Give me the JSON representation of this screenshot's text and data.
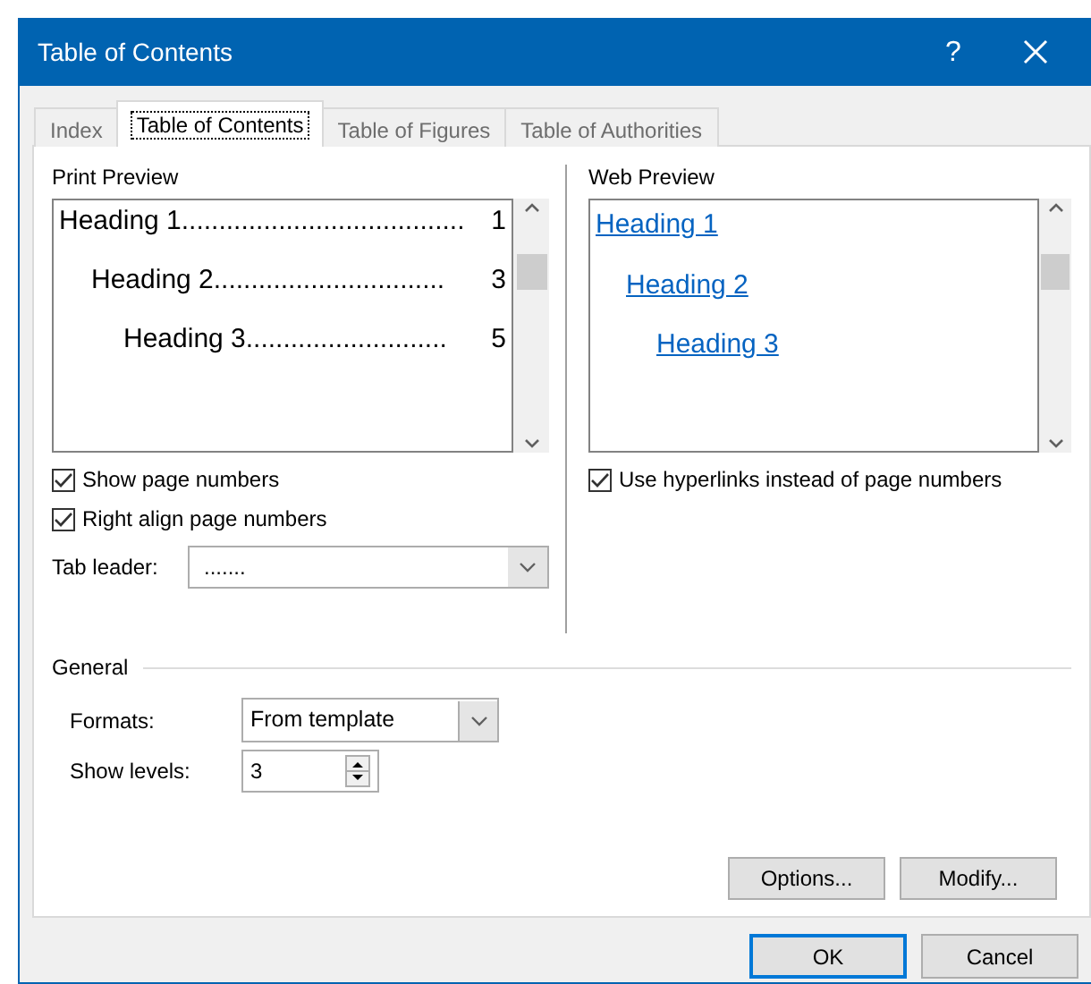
{
  "window": {
    "title": "Table of Contents",
    "help": "?"
  },
  "tabs": [
    {
      "label": "Index",
      "selected": false
    },
    {
      "label": "Table of Contents",
      "selected": true
    },
    {
      "label": "Table of Figures",
      "selected": false
    },
    {
      "label": "Table of Authorities",
      "selected": false
    }
  ],
  "print_preview": {
    "label": "Print Preview",
    "entries": [
      {
        "heading": "Heading 1",
        "leader": "......................................",
        "page": "1",
        "children": [
          {
            "heading": "Heading 2",
            "leader": "...............................",
            "page": "3",
            "children": [
              {
                "heading": "Heading 3",
                "leader": "...........................",
                "page": "5"
              }
            ]
          }
        ]
      }
    ]
  },
  "print_options": [
    {
      "label": "Show page numbers",
      "checked": true
    },
    {
      "label": "Right align page numbers",
      "checked": true
    }
  ],
  "tab_leader": {
    "label": "Tab leader:",
    "value": "......."
  },
  "web_preview": {
    "label": "Web Preview",
    "entries": [
      {
        "heading": "Heading 1",
        "children": [
          {
            "heading": "Heading 2",
            "children": [
              {
                "heading": "Heading 3"
              }
            ]
          }
        ]
      }
    ]
  },
  "web_options": [
    {
      "label": "Use hyperlinks instead of page numbers",
      "checked": true
    }
  ],
  "general": {
    "title": "General",
    "formats": {
      "label": "Formats:",
      "value": "From template"
    },
    "show_levels": {
      "label": "Show levels:",
      "value": "3"
    }
  },
  "panel_buttons": [
    "Options...",
    "Modify..."
  ],
  "dialog_buttons": [
    {
      "label": "OK",
      "default": true
    },
    {
      "label": "Cancel",
      "default": false
    }
  ]
}
